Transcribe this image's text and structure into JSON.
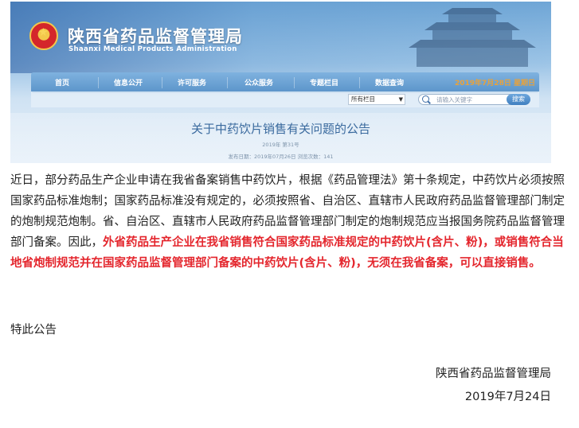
{
  "header": {
    "org_name_cn": "陕西省药品监督管理局",
    "org_name_en": "Shaanxi Medical Products Administration",
    "emblem": "national-emblem-icon"
  },
  "nav": {
    "items": [
      "首页",
      "信息公开",
      "许可服务",
      "公众服务",
      "专题栏目",
      "数据查询"
    ],
    "date": "2019年7月28日 星期日"
  },
  "search": {
    "select_value": "所有栏目",
    "placeholder": "请输入关键字",
    "button_label": "搜索"
  },
  "article": {
    "title": "关于中药饮片销售有关问题的公告",
    "subtitle": "2019年 第31号",
    "meta": "发布日期：2019年07月26日   浏览次数：141",
    "body_normal": "近日，部分药品生产企业申请在我省备案销售中药饮片，根据《药品管理法》第十条规定，中药饮片必须按照国家药品标准炮制；国家药品标准没有规定的，必须按照省、自治区、直辖市人民政府药品监督管理部门制定的炮制规范炮制。省、自治区、直辖市人民政府药品监督管理部门制定的炮制规范应当报国务院药品监督管理部门备案。因此，",
    "body_highlight": "外省药品生产企业在我省销售符合国家药品标准规定的中药饮片(含片、粉)，或销售符合当地省炮制规范并在国家药品监督管理部门备案的中药饮片(含片、粉)，无须在我省备案，可以直接销售。",
    "notice": "特此公告",
    "signature_org": "陕西省药品监督管理局",
    "signature_date": "2019年7月24日"
  },
  "colors": {
    "highlight": "#e4262d",
    "nav_bg": "#5a93c9",
    "title_blue": "#3a6a9e"
  }
}
